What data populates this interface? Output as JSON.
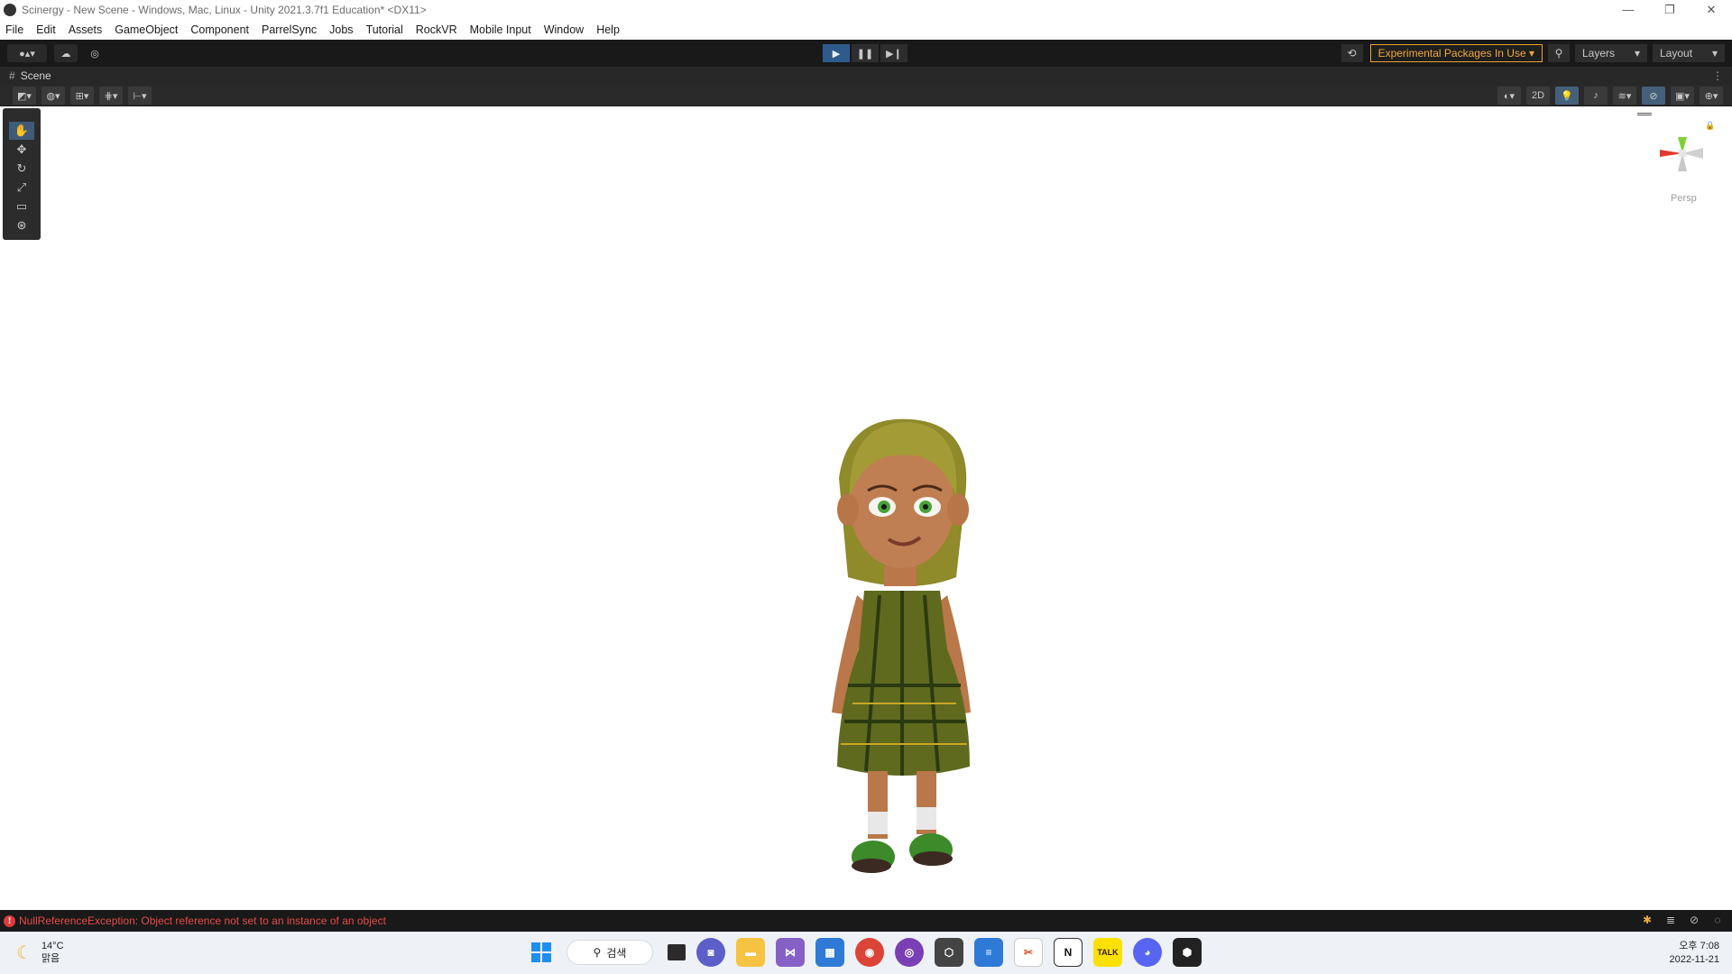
{
  "window": {
    "title": "Scinergy - New Scene - Windows, Mac, Linux - Unity 2021.3.7f1 Education* <DX11>",
    "controls": [
      "—",
      "❐",
      "✕"
    ]
  },
  "menu": [
    "File",
    "Edit",
    "Assets",
    "GameObject",
    "Component",
    "ParrelSync",
    "Jobs",
    "Tutorial",
    "RockVR",
    "Mobile Input",
    "Window",
    "Help"
  ],
  "toolbar": {
    "play_icon": "▶",
    "pause_icon": "❚❚",
    "step_icon": "▶❙",
    "experimental": "Experimental Packages In Use ▾",
    "layers": "Layers",
    "layout": "Layout"
  },
  "scene": {
    "tab_label": "Scene",
    "mode_2d": "2D",
    "persp_label": "Persp"
  },
  "status": {
    "error_message": "NullReferenceException: Object reference not set to an instance of an object"
  },
  "taskbar": {
    "weather_temp": "14°C",
    "weather_desc": "맑음",
    "search_label": "검색",
    "time": "오후 7:08",
    "date": "2022-11-21"
  },
  "colors": {
    "accent_blue": "#2f5b8c",
    "warning_orange": "#f0a93a",
    "error_red": "#e84a4a"
  }
}
